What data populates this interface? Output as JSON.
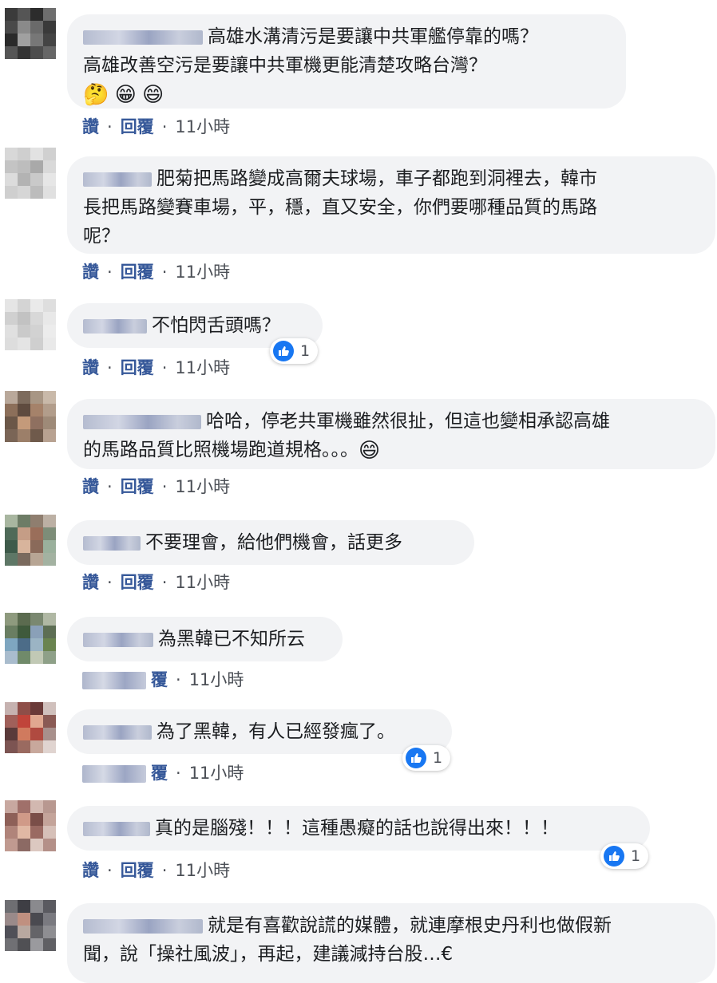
{
  "comments": [
    {
      "lines": [
        "高雄水溝清污是要讓中共軍艦停靠的嗎？",
        "高雄改善空污是要讓中共軍機更能清楚攻略台灣？"
      ],
      "emojis": [
        "🤔",
        "😁",
        "😄"
      ],
      "actions": {
        "like": "讚",
        "reply": "回覆",
        "time": "11小時"
      }
    },
    {
      "lines": [
        "肥菊把馬路變成高爾夫球場，車子都跑到洞裡去，韓市",
        "長把馬路變賽車場，平，穩，直又安全，你們要哪種品質的馬路",
        "呢？"
      ],
      "actions": {
        "like": "讚",
        "reply": "回覆",
        "time": "11小時"
      }
    },
    {
      "lines": [
        "不怕閃舌頭嗎？"
      ],
      "actions": {
        "like": "讚",
        "reply": "回覆",
        "time": "11小時"
      },
      "reaction_count": "1"
    },
    {
      "lines": [
        "哈哈，停老共軍機雖然很扯，但這也變相承認高雄",
        "的馬路品質比照機場跑道規格。。。"
      ],
      "emojis": [
        "😄"
      ],
      "actions": {
        "like": "讚",
        "reply": "回覆",
        "time": "11小時"
      }
    },
    {
      "lines": [
        "不要理會，給他們機會，話更多"
      ],
      "actions": {
        "like": "讚",
        "reply": "回覆",
        "time": "11小時"
      }
    },
    {
      "lines": [
        "為黑韓已不知所云"
      ],
      "actions": {
        "partial": "覆",
        "time": "11小時"
      }
    },
    {
      "lines": [
        "為了黑韓，有人已經發瘋了。"
      ],
      "actions": {
        "partial": "覆",
        "time": "11小時"
      },
      "reaction_count": "1"
    },
    {
      "lines": [
        "真的是腦殘！！！這種愚癡的話也說得出來！！！"
      ],
      "actions": {
        "like": "讚",
        "reply": "回覆",
        "time": "11小時"
      },
      "reaction_count": "1"
    },
    {
      "lines": [
        "就是有喜歡說謊的媒體，就連摩根史丹利也做假新",
        "聞，說「操社風波」，再起，建議減持台股…€"
      ]
    }
  ],
  "icons": {
    "like": "thumbs-up-icon",
    "avatar": "blurred-avatar"
  },
  "colors": {
    "bubble": "#f2f3f5",
    "link": "#365899",
    "like_badge": "#1877f2"
  }
}
